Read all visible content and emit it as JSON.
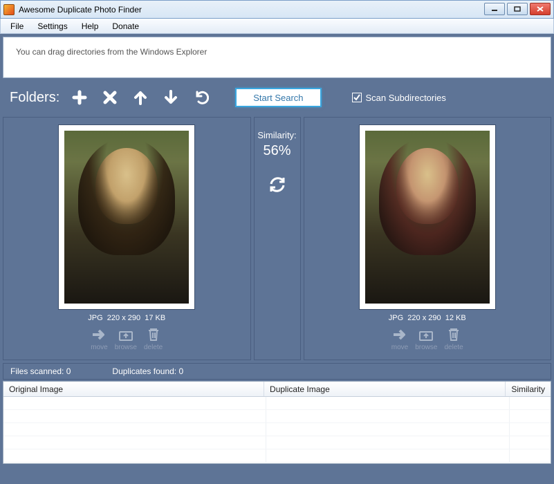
{
  "window": {
    "title": "Awesome Duplicate Photo Finder"
  },
  "menu": {
    "file": "File",
    "settings": "Settings",
    "help": "Help",
    "donate": "Donate"
  },
  "drop_hint": "You can drag directories from the Windows Explorer",
  "toolbar": {
    "label": "Folders:",
    "start_label": "Start Search",
    "scan_sub_label": "Scan Subdirectories",
    "scan_sub_checked": true
  },
  "similarity": {
    "label": "Similarity:",
    "value": "56%"
  },
  "left_image": {
    "format": "JPG",
    "dimensions": "220 x 290",
    "size": "17 KB"
  },
  "right_image": {
    "format": "JPG",
    "dimensions": "220 x 290",
    "size": "12 KB"
  },
  "actions": {
    "move": "move",
    "browse": "browse",
    "delete": "delete"
  },
  "status": {
    "scanned_label": "Files scanned:",
    "scanned_value": "0",
    "dup_label": "Duplicates found:",
    "dup_value": "0"
  },
  "table": {
    "col_original": "Original Image",
    "col_duplicate": "Duplicate Image",
    "col_similarity": "Similarity",
    "rows": []
  }
}
